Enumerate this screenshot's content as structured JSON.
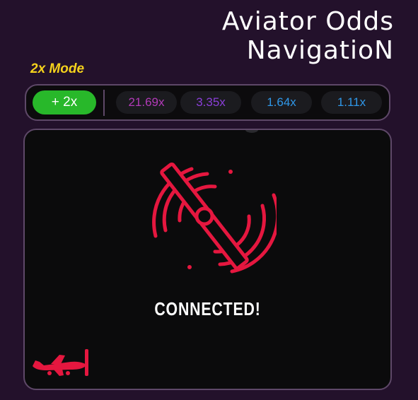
{
  "header": {
    "title_line1": "Aviator Odds",
    "title_line2": "NavigatioN"
  },
  "mode": {
    "label": "2x Mode",
    "button_label": "+ 2x"
  },
  "odds": [
    {
      "value": "21.69x",
      "color": "#b23ab8"
    },
    {
      "value": "3.35x",
      "color": "#8a3ed8"
    },
    {
      "value": "1.64x",
      "color": "#2f97e8"
    },
    {
      "value": "1.11x",
      "color": "#2f97e8"
    }
  ],
  "status": {
    "text": "CONNECTED!",
    "icon": "connected-plane-icon"
  },
  "colors": {
    "accent_red": "#e5173f",
    "mode_green": "#28b82a",
    "mode_label_yellow": "#f5d21c",
    "background": "#23112b"
  },
  "logo": {
    "icon": "aviator-plane-logo"
  }
}
